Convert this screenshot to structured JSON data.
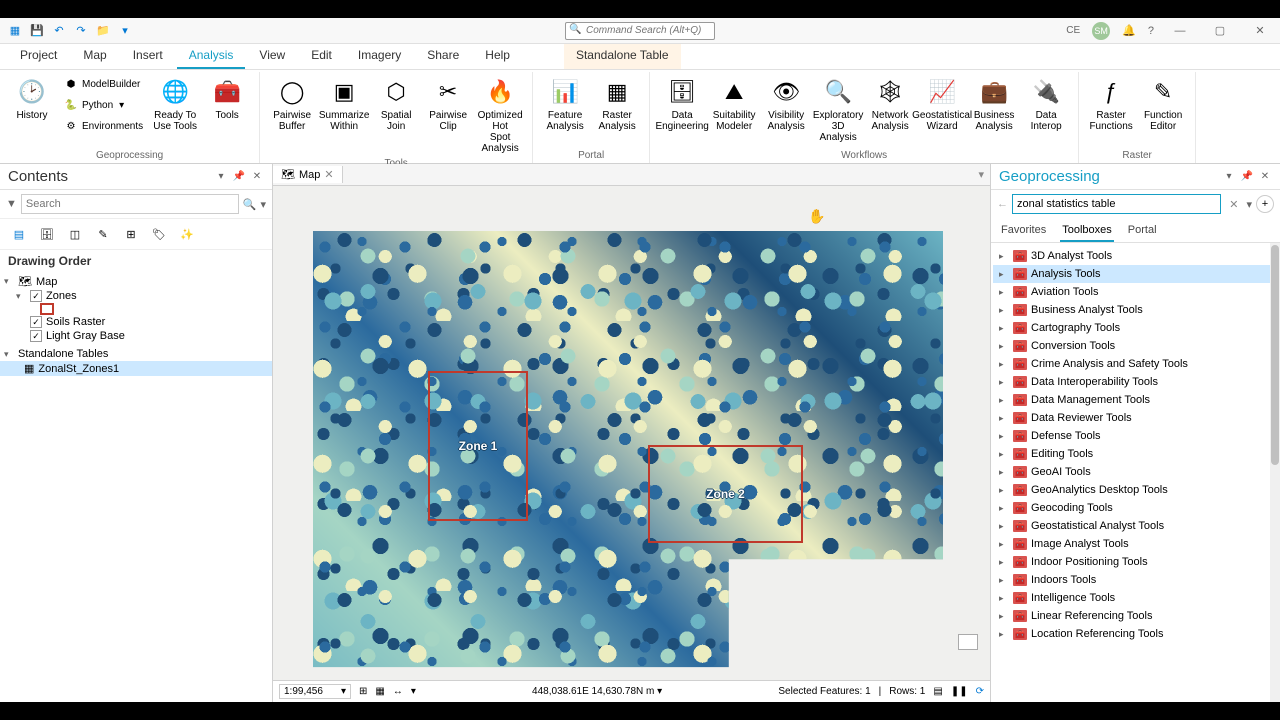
{
  "titlebar": {
    "user_initials_1": "CE",
    "user_initials_2": "SM",
    "cmd_search_placeholder": "Command Search (Alt+Q)"
  },
  "tabs": [
    "Project",
    "Map",
    "Insert",
    "Analysis",
    "View",
    "Edit",
    "Imagery",
    "Share",
    "Help"
  ],
  "active_tab": "Analysis",
  "contextual_tab": "Standalone Table",
  "ribbon": {
    "groups": {
      "geoprocessing": {
        "label": "Geoprocessing",
        "history": "History",
        "modelbuilder": "ModelBuilder",
        "python": "Python",
        "environments": "Environments",
        "ready": "Ready To\nUse Tools",
        "tools": "Tools"
      },
      "tools": {
        "label": "Tools",
        "items": [
          "Pairwise\nBuffer",
          "Summarize\nWithin",
          "Spatial\nJoin",
          "Pairwise\nClip",
          "Optimized Hot\nSpot Analysis"
        ]
      },
      "portal": {
        "label": "Portal",
        "items": [
          "Feature\nAnalysis",
          "Raster\nAnalysis"
        ]
      },
      "workflows": {
        "label": "Workflows",
        "items": [
          "Data\nEngineering",
          "Suitability\nModeler",
          "Visibility\nAnalysis",
          "Exploratory\n3D Analysis",
          "Network\nAnalysis",
          "Geostatistical\nWizard",
          "Business\nAnalysis",
          "Data\nInterop"
        ]
      },
      "raster": {
        "label": "Raster",
        "items": [
          "Raster\nFunctions",
          "Function\nEditor"
        ]
      }
    }
  },
  "contents": {
    "title": "Contents",
    "search_placeholder": "Search",
    "drawing_order": "Drawing Order",
    "map_node": "Map",
    "layers": [
      {
        "name": "Zones",
        "checked": true,
        "has_legend": true
      },
      {
        "name": "Soils Raster",
        "checked": true
      },
      {
        "name": "Light Gray Base",
        "checked": true
      }
    ],
    "standalone_header": "Standalone Tables",
    "standalone_items": [
      "ZonalSt_Zones1"
    ]
  },
  "map": {
    "tab_label": "Map",
    "zone1_label": "Zone 1",
    "zone2_label": "Zone 2",
    "scale": "1:99,456",
    "coords": "448,038.61E 14,630.78N m",
    "selected": "Selected Features: 1",
    "rows": "Rows: 1"
  },
  "geoprocessing": {
    "title": "Geoprocessing",
    "search_value": "zonal statistics table",
    "tabs": [
      "Favorites",
      "Toolboxes",
      "Portal"
    ],
    "active_tab": "Toolboxes",
    "toolboxes": [
      "3D Analyst Tools",
      "Analysis Tools",
      "Aviation Tools",
      "Business Analyst Tools",
      "Cartography Tools",
      "Conversion Tools",
      "Crime Analysis and Safety Tools",
      "Data Interoperability Tools",
      "Data Management Tools",
      "Data Reviewer Tools",
      "Defense Tools",
      "Editing Tools",
      "GeoAI Tools",
      "GeoAnalytics Desktop Tools",
      "Geocoding Tools",
      "Geostatistical Analyst Tools",
      "Image Analyst Tools",
      "Indoor Positioning Tools",
      "Indoors Tools",
      "Intelligence Tools",
      "Linear Referencing Tools",
      "Location Referencing Tools"
    ],
    "selected_toolbox": "Analysis Tools"
  }
}
